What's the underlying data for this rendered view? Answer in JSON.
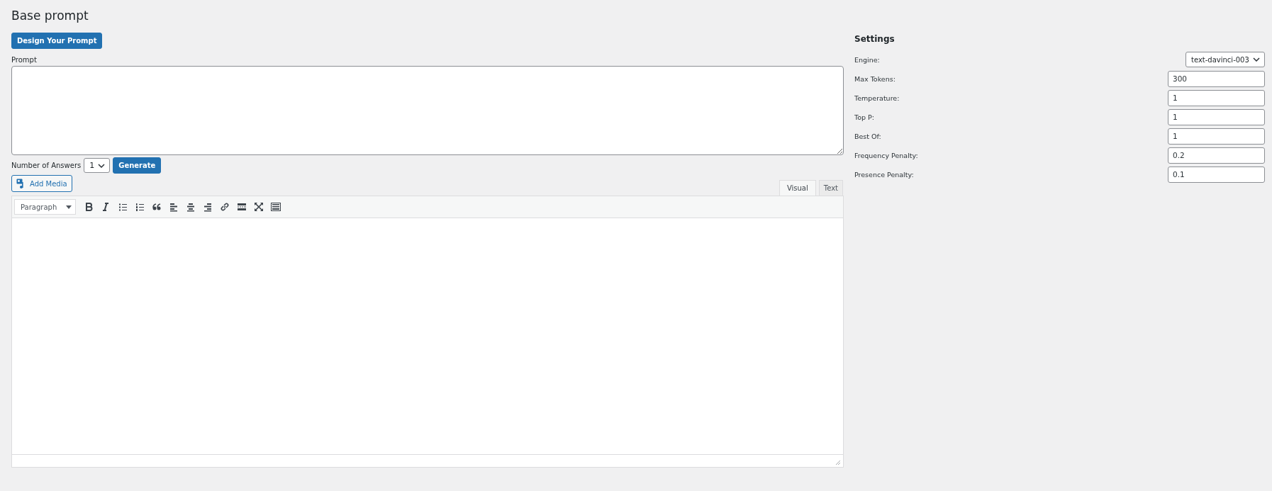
{
  "page_title": "Base prompt",
  "design_button": "Design Your Prompt",
  "prompt": {
    "label": "Prompt"
  },
  "answers": {
    "label": "Number of Answers",
    "value": "1",
    "generate_button": "Generate"
  },
  "add_media_button": "Add Media",
  "editor": {
    "tabs": [
      {
        "label": "Visual",
        "selected": true
      },
      {
        "label": "Text",
        "selected": false
      }
    ],
    "format": "Paragraph"
  },
  "settings": {
    "title": "Settings",
    "fields": [
      {
        "kind": "select",
        "label": "Engine:",
        "value": "text-davinci-003"
      },
      {
        "kind": "input",
        "label": "Max Tokens:",
        "value": "300"
      },
      {
        "kind": "input",
        "label": "Temperature:",
        "value": "1"
      },
      {
        "kind": "input",
        "label": "Top P:",
        "value": "1"
      },
      {
        "kind": "input",
        "label": "Best Of:",
        "value": "1"
      },
      {
        "kind": "input",
        "label": "Frequency Penalty:",
        "value": "0.2"
      },
      {
        "kind": "input",
        "label": "Presence Penalty:",
        "value": "0.1"
      }
    ]
  }
}
